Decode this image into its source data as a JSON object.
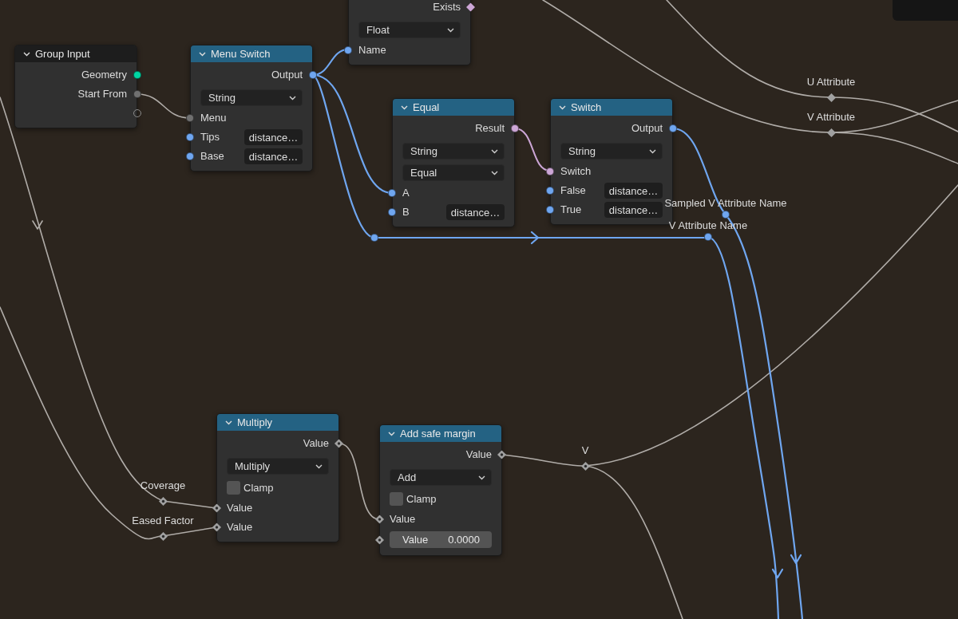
{
  "nodes": [
    {
      "title": "Group Input",
      "color": "#1d1d1d",
      "rows": [
        {
          "kind": "output",
          "label": "Geometry",
          "socket": {
            "kind": "dot",
            "color": "#00d6a3"
          }
        },
        {
          "kind": "output",
          "label": "Start From",
          "socket": {
            "kind": "dot",
            "color": "#707070"
          }
        },
        {
          "kind": "output",
          "socket": {
            "kind": "ring",
            "color": "#8c8c8c"
          }
        }
      ]
    },
    {
      "title": "Menu Switch",
      "color": "#246283",
      "rows": [
        {
          "kind": "output",
          "label": "Output",
          "socket": {
            "kind": "dot",
            "color": "#6fa6f0"
          }
        },
        {
          "kind": "dropdown",
          "value": "String"
        },
        {
          "kind": "input",
          "label": "Menu",
          "socket": {
            "kind": "dot",
            "color": "#707070"
          }
        },
        {
          "kind": "input",
          "label": "Tips",
          "socket": {
            "kind": "dot",
            "color": "#6fa6f0"
          },
          "value": "distance…"
        },
        {
          "kind": "input",
          "label": "Base",
          "socket": {
            "kind": "dot",
            "color": "#6fa6f0"
          },
          "value": "distance…"
        }
      ]
    },
    {
      "rows": [
        {
          "kind": "output",
          "label": "Exists",
          "socket": {
            "kind": "diamond",
            "color": "#cca6d6"
          }
        },
        {
          "kind": "dropdown",
          "value": "Float"
        },
        {
          "kind": "input",
          "label": "Name",
          "socket": {
            "kind": "dot",
            "color": "#6fa6f0"
          }
        }
      ]
    },
    {
      "title": "Equal",
      "color": "#246283",
      "rows": [
        {
          "kind": "output",
          "label": "Result",
          "socket": {
            "kind": "dot",
            "color": "#cca6d6"
          }
        },
        {
          "kind": "dropdown",
          "value": "String"
        },
        {
          "kind": "dropdown",
          "value": "Equal"
        },
        {
          "kind": "input",
          "label": "A",
          "socket": {
            "kind": "dot",
            "color": "#6fa6f0"
          }
        },
        {
          "kind": "input",
          "label": "B",
          "socket": {
            "kind": "dot",
            "color": "#6fa6f0"
          },
          "value": "distance…"
        }
      ]
    },
    {
      "title": "Switch",
      "color": "#246283",
      "rows": [
        {
          "kind": "output",
          "label": "Output",
          "socket": {
            "kind": "dot",
            "color": "#6fa6f0"
          }
        },
        {
          "kind": "dropdown",
          "value": "String"
        },
        {
          "kind": "input",
          "label": "Switch",
          "socket": {
            "kind": "dot",
            "color": "#cca6d6"
          }
        },
        {
          "kind": "input",
          "label": "False",
          "socket": {
            "kind": "dot",
            "color": "#6fa6f0"
          },
          "value": "distance…"
        },
        {
          "kind": "input",
          "label": "True",
          "socket": {
            "kind": "dot",
            "color": "#6fa6f0"
          },
          "value": "distance…"
        }
      ]
    },
    {
      "title": "Multiply",
      "color": "#246283",
      "rows": [
        {
          "kind": "output",
          "label": "Value",
          "socket": {
            "kind": "field_diamond",
            "color": "#a1a1a1"
          }
        },
        {
          "kind": "dropdown",
          "value": "Multiply"
        },
        {
          "kind": "checkbox",
          "label": "Clamp",
          "checked": false
        },
        {
          "kind": "input",
          "label": "Value",
          "socket": {
            "kind": "field_diamond",
            "color": "#a1a1a1"
          }
        },
        {
          "kind": "input",
          "label": "Value",
          "socket": {
            "kind": "field_diamond",
            "color": "#a1a1a1"
          }
        }
      ]
    },
    {
      "title": "Add safe margin",
      "color": "#246283",
      "rows": [
        {
          "kind": "output",
          "label": "Value",
          "socket": {
            "kind": "field_diamond",
            "color": "#a1a1a1"
          }
        },
        {
          "kind": "dropdown",
          "value": "Add"
        },
        {
          "kind": "checkbox",
          "label": "Clamp",
          "checked": false
        },
        {
          "kind": "input",
          "label": "Value",
          "socket": {
            "kind": "field_diamond",
            "color": "#a1a1a1"
          }
        },
        {
          "kind": "number",
          "label": "Value",
          "value": "0.0000",
          "socket": {
            "kind": "field_diamond",
            "color": "#a1a1a1"
          }
        }
      ]
    }
  ],
  "reroutes": [
    {
      "label": "U Attribute",
      "kind": "diamond",
      "color": "#a1a1a1"
    },
    {
      "label": "V Attribute",
      "kind": "diamond",
      "color": "#a1a1a1"
    },
    {
      "label": "Sampled V Attribute Name",
      "kind": "dot",
      "color": "#6fa6f0"
    },
    {
      "label": "V Attribute Name",
      "kind": "dot",
      "color": "#6fa6f0"
    },
    {
      "kind": "dot",
      "color": "#6fa6f0"
    },
    {
      "label": "V",
      "kind": "field_diamond",
      "color": "#a1a1a1"
    },
    {
      "label": "Coverage",
      "kind": "field_diamond",
      "color": "#a1a1a1"
    },
    {
      "label": "Eased Factor",
      "kind": "field_diamond",
      "color": "#a1a1a1"
    }
  ]
}
